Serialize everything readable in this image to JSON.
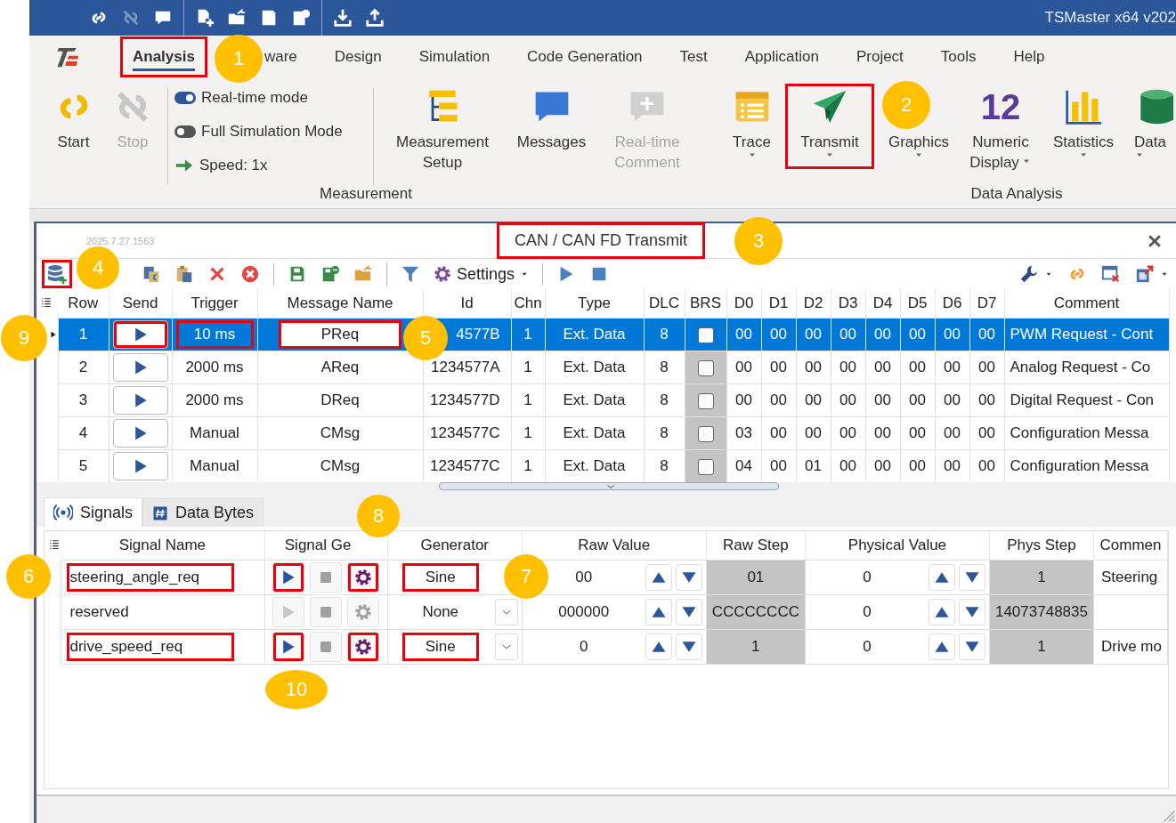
{
  "title_bar": {
    "title": "TSMaster x64 v202"
  },
  "menu_tabs": [
    {
      "label": "Analysis",
      "selected": true,
      "highlight": true
    },
    {
      "label": "ware",
      "selected": false,
      "highlight": false
    },
    {
      "label": "Design",
      "selected": false,
      "highlight": false
    },
    {
      "label": "Simulation",
      "selected": false,
      "highlight": false
    },
    {
      "label": "Code Generation",
      "selected": false,
      "highlight": false
    },
    {
      "label": "Test",
      "selected": false,
      "highlight": false
    },
    {
      "label": "Application",
      "selected": false,
      "highlight": false
    },
    {
      "label": "Project",
      "selected": false,
      "highlight": false
    },
    {
      "label": "Tools",
      "selected": false,
      "highlight": false
    },
    {
      "label": "Help",
      "selected": false,
      "highlight": false
    }
  ],
  "ribbon": {
    "groups": [
      {
        "label": "Measurement",
        "items": [
          {
            "kind": "big",
            "label": "Start",
            "disabled": false,
            "dropdown": false,
            "highlight": false
          },
          {
            "kind": "big",
            "label": "Stop",
            "disabled": true,
            "dropdown": false,
            "highlight": false
          },
          {
            "kind": "options",
            "rows": [
              {
                "kind": "toggle",
                "label": "Real-time mode",
                "on": true
              },
              {
                "kind": "toggle",
                "label": "Full Simulation Mode",
                "on": false
              },
              {
                "kind": "speed",
                "label": "Speed: 1x"
              }
            ]
          },
          {
            "kind": "big",
            "label": "Measurement Setup",
            "disabled": false,
            "dropdown": false,
            "highlight": false
          },
          {
            "kind": "big",
            "label": "Messages",
            "disabled": false,
            "dropdown": false,
            "highlight": false
          },
          {
            "kind": "big",
            "label": "Real-time Comment",
            "disabled": true,
            "dropdown": false,
            "highlight": false
          }
        ]
      },
      {
        "label": "Data Analysis",
        "items": [
          {
            "kind": "big",
            "label": "Trace",
            "disabled": false,
            "dropdown": true,
            "highlight": false
          },
          {
            "kind": "big",
            "label": "Transmit",
            "disabled": false,
            "dropdown": true,
            "highlight": true
          },
          {
            "kind": "big",
            "label": "Graphics",
            "disabled": false,
            "dropdown": true,
            "highlight": false
          },
          {
            "kind": "big",
            "label": "Numeric Display",
            "glyph": "12",
            "disabled": false,
            "dropdown": true,
            "highlight": false
          },
          {
            "kind": "big",
            "label": "Statistics",
            "disabled": false,
            "dropdown": true,
            "highlight": false
          },
          {
            "kind": "big",
            "label": "Data",
            "disabled": false,
            "dropdown": true,
            "highlight": false
          }
        ]
      }
    ]
  },
  "transmit_window": {
    "version": "2025.7.27.1563",
    "title": "CAN / CAN FD Transmit",
    "title_highlight": true,
    "toolbar": {
      "add_highlight": true,
      "settings": "Settings"
    },
    "table": {
      "columns": [
        "Row",
        "Send",
        "Trigger",
        "Message Name",
        "Id",
        "Chn",
        "Type",
        "DLC",
        "BRS",
        "D0",
        "D1",
        "D2",
        "D3",
        "D4",
        "D5",
        "D6",
        "D7",
        "Comment"
      ],
      "rows": [
        {
          "row": "1",
          "trigger": "10 ms",
          "name": "PReq",
          "id": "4577B",
          "chn": "1",
          "type": "Ext. Data",
          "dlc": "8",
          "brs": false,
          "data": [
            "00",
            "00",
            "00",
            "00",
            "00",
            "00",
            "00",
            "00"
          ],
          "comment": "PWM Request - Cont",
          "selected": true,
          "send_highlight": true,
          "trigger_highlight": true,
          "name_highlight": true
        },
        {
          "row": "2",
          "trigger": "2000 ms",
          "name": "AReq",
          "id": "1234577A",
          "chn": "1",
          "type": "Ext. Data",
          "dlc": "8",
          "brs": false,
          "data": [
            "00",
            "00",
            "00",
            "00",
            "00",
            "00",
            "00",
            "00"
          ],
          "comment": "Analog Request - Co",
          "selected": false,
          "send_highlight": false,
          "trigger_highlight": false,
          "name_highlight": false
        },
        {
          "row": "3",
          "trigger": "2000 ms",
          "name": "DReq",
          "id": "1234577D",
          "chn": "1",
          "type": "Ext. Data",
          "dlc": "8",
          "brs": false,
          "data": [
            "00",
            "00",
            "00",
            "00",
            "00",
            "00",
            "00",
            "00"
          ],
          "comment": "Digital Request - Con",
          "selected": false,
          "send_highlight": false,
          "trigger_highlight": false,
          "name_highlight": false
        },
        {
          "row": "4",
          "trigger": "Manual",
          "name": "CMsg",
          "id": "1234577C",
          "chn": "1",
          "type": "Ext. Data",
          "dlc": "8",
          "brs": false,
          "data": [
            "03",
            "00",
            "00",
            "00",
            "00",
            "00",
            "00",
            "00"
          ],
          "comment": "Configuration Messa",
          "selected": false,
          "send_highlight": false,
          "trigger_highlight": false,
          "name_highlight": false
        },
        {
          "row": "5",
          "trigger": "Manual",
          "name": "CMsg",
          "id": "1234577C",
          "chn": "1",
          "type": "Ext. Data",
          "dlc": "8",
          "brs": false,
          "data": [
            "04",
            "00",
            "01",
            "00",
            "00",
            "00",
            "00",
            "00"
          ],
          "comment": "Configuration Messa",
          "selected": false,
          "send_highlight": false,
          "trigger_highlight": false,
          "name_highlight": false
        }
      ]
    },
    "tabs": [
      {
        "label": "Signals",
        "selected": true
      },
      {
        "label": "Data Bytes",
        "selected": false
      }
    ],
    "signals": {
      "columns": [
        "Signal Name",
        "Signal Ge",
        "Generator",
        "Raw Value",
        "Raw Step",
        "Physical Value",
        "Phys Step",
        "Commen"
      ],
      "rows": [
        {
          "name": "steering_angle_req",
          "enabled": true,
          "highlight": true,
          "generator": "Sine",
          "dropdown": false,
          "raw": "00",
          "raw_step": "01",
          "phys": "0",
          "phys_step": "1",
          "comment": "Steering"
        },
        {
          "name": "reserved",
          "enabled": false,
          "highlight": false,
          "generator": "None",
          "dropdown": true,
          "raw": "000000",
          "raw_step": "CCCCCCCC",
          "phys": "0",
          "phys_step": "14073748835"
        },
        {
          "name": "drive_speed_req",
          "enabled": true,
          "highlight": true,
          "generator": "Sine",
          "dropdown": true,
          "raw": "0",
          "raw_step": "1",
          "phys": "0",
          "phys_step": "1",
          "comment": "Drive mo"
        }
      ]
    }
  },
  "callouts": [
    {
      "number": "1"
    },
    {
      "number": "2"
    },
    {
      "number": "3"
    },
    {
      "number": "4"
    },
    {
      "number": "5"
    },
    {
      "number": "6"
    },
    {
      "number": "7"
    },
    {
      "number": "8"
    },
    {
      "number": "9"
    },
    {
      "number": "10"
    }
  ]
}
